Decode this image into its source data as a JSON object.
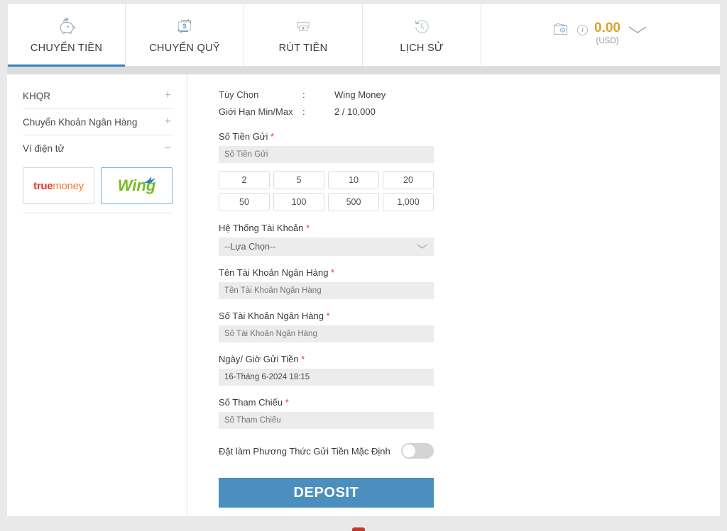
{
  "header": {
    "tabs": [
      {
        "label": "CHUYỂN TIỀN",
        "icon": "piggy-bank-icon",
        "active": true
      },
      {
        "label": "CHUYỂN QUỸ",
        "icon": "transfer-funds-icon",
        "active": false
      },
      {
        "label": "RÚT TIỀN",
        "icon": "cash-withdraw-icon",
        "active": false
      },
      {
        "label": "LỊCH SỬ",
        "icon": "history-clock-icon",
        "active": false
      }
    ],
    "balance": {
      "wallet_icon": "wallet-icon",
      "info_icon": "info-icon",
      "info_glyph": "i",
      "amount": "0.00",
      "currency": "(USD)",
      "caret_icon": "chevron-down-icon",
      "amount_color": "#d9a227"
    }
  },
  "sidebar": {
    "groups": [
      {
        "label": "KHQR",
        "sign": "+",
        "expanded": false
      },
      {
        "label": "Chuyển Khoản Ngân Hàng",
        "sign": "+",
        "expanded": false
      },
      {
        "label": "Ví điện tử",
        "sign": "−",
        "expanded": true
      }
    ],
    "wallets": [
      {
        "name": "truemoney",
        "part1": "true",
        "part2": "money",
        "selected": false
      },
      {
        "name": "Wing",
        "text": "Wing",
        "selected": true
      }
    ]
  },
  "form": {
    "info_rows": [
      {
        "key": "Tùy Chọn",
        "colon": ":",
        "value": "Wing Money"
      },
      {
        "key": "Giới Hạn Min/Max",
        "colon": ":",
        "value": "2 / 10,000"
      }
    ],
    "amount": {
      "label": "Số Tiền Gửi",
      "required": "*",
      "placeholder": "Số Tiền Gửi",
      "value": ""
    },
    "quick_amounts": [
      "2",
      "5",
      "10",
      "20",
      "50",
      "100",
      "500",
      "1,000"
    ],
    "account_system": {
      "label": "Hệ Thống Tài Khoản",
      "required": "*",
      "selected": "--Lựa Chọn--"
    },
    "bank_account_name": {
      "label": "Tên Tài Khoản Ngân Hàng",
      "required": "*",
      "placeholder": "Tên Tài Khoản Ngân Hàng",
      "value": ""
    },
    "bank_account_number": {
      "label": "Số Tài Khoản Ngân Hàng",
      "required": "*",
      "placeholder": "Số Tài Khoản Ngân Hàng",
      "value": ""
    },
    "deposit_datetime": {
      "label": "Ngày/ Giờ Gửi Tiền",
      "required": "*",
      "value": "16-Tháng 6-2024 18:15"
    },
    "reference_number": {
      "label": "Số Tham Chiếu",
      "required": "*",
      "placeholder": "Số Tham Chiếu",
      "value": ""
    },
    "default_toggle": {
      "label": "Đặt làm Phương Thức Gửi Tiền Mặc Định",
      "state": "off"
    },
    "submit_label": "DEPOSIT",
    "submit_color": "#4a8fbd"
  }
}
